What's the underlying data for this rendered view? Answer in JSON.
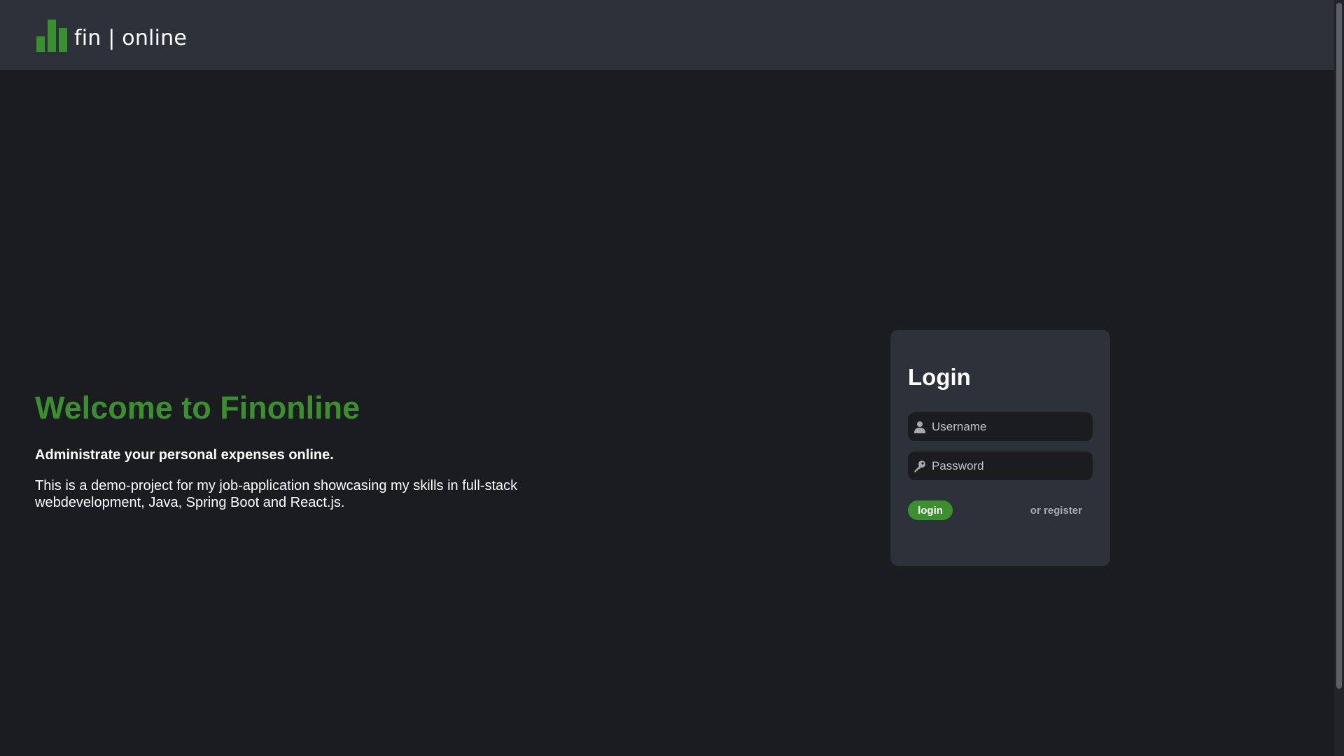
{
  "header": {
    "logo_text": "fin | online",
    "logo_icon": "bar-chart-icon",
    "background_color": "#2c313a"
  },
  "welcome": {
    "title": "Welcome to Finonline",
    "subtitle": "Administrate your personal expenses online.",
    "description": "This is a demo-project for my job-application showcasing my skills in full-stack webdevelopment, Java, Spring Boot and React.js."
  },
  "login": {
    "title": "Login",
    "username": {
      "placeholder": "Username",
      "value": "",
      "icon": "user-icon"
    },
    "password": {
      "placeholder": "Password",
      "value": "",
      "icon": "key-icon"
    },
    "login_button_label": "login",
    "register_link_label": "or register"
  },
  "colors": {
    "accent": "#3a8f2e",
    "page_background": "#1b1c20",
    "card_background": "#2c313a",
    "text": "#ffffff",
    "muted_text": "#a6a9ae"
  }
}
